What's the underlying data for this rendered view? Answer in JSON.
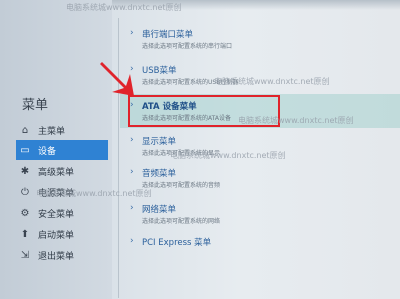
{
  "sidebar": {
    "title": "菜单",
    "items": [
      {
        "label": "主菜单",
        "icon": "home-icon",
        "glyph": "⌂",
        "active": false
      },
      {
        "label": "设备",
        "icon": "devices-icon",
        "glyph": "▭",
        "active": true
      },
      {
        "label": "高级菜单",
        "icon": "advanced-icon",
        "glyph": "✱",
        "active": false
      },
      {
        "label": "电源菜单",
        "icon": "power-icon",
        "glyph": "⏻",
        "active": false
      },
      {
        "label": "安全菜单",
        "icon": "security-icon",
        "glyph": "⚙",
        "active": false
      },
      {
        "label": "启动菜单",
        "icon": "boot-icon",
        "glyph": "⬆",
        "active": false
      },
      {
        "label": "退出菜单",
        "icon": "exit-icon",
        "glyph": "⇲",
        "active": false
      }
    ]
  },
  "main": {
    "entries": [
      {
        "title": "串行端口菜单",
        "desc": "选择此选项可配置系统的串行端口"
      },
      {
        "title": "USB菜单",
        "desc": "选择此选项可配置系统的USB控制器"
      },
      {
        "title": "ATA 设备菜单",
        "desc": "选择此选项可配置系统的ATA设备"
      },
      {
        "title": "显示菜单",
        "desc": "选择此选项可配置系统的显示"
      },
      {
        "title": "音频菜单",
        "desc": "选择此选项可配置系统的音频"
      },
      {
        "title": "网络菜单",
        "desc": "选择此选项可配置系统的网络"
      },
      {
        "title": "PCI Express 菜单",
        "desc": ""
      }
    ]
  },
  "watermarks": [
    "电脑系统城www.dnxtc.net原创",
    "电脑系统城www.dnxtc.net原创",
    "电脑系统城www.dnxtc.net原创",
    "电脑系统城www.dnxtc.net原创",
    "电脑系统城www.dnxtc.net原创"
  ],
  "colors": {
    "accent": "#2f82d3",
    "highlight_box": "#e0232b",
    "title_text": "#2a5f9b"
  }
}
